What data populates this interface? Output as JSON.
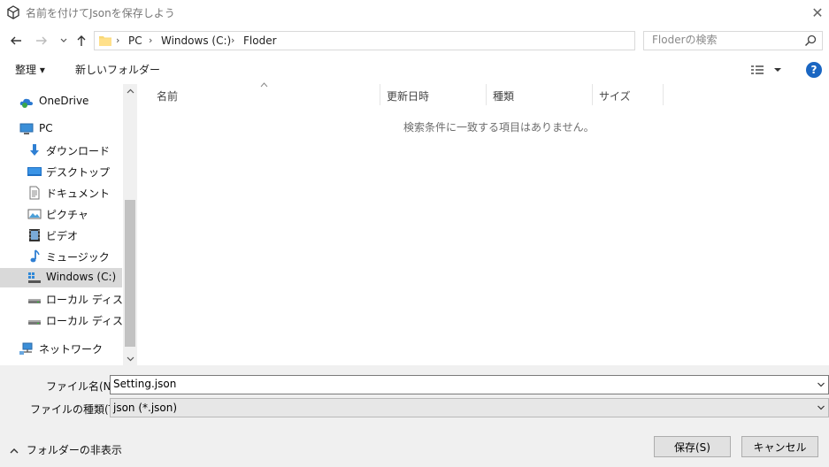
{
  "window": {
    "title": "名前を付けてJsonを保存しよう",
    "close_glyph": "✕"
  },
  "address": {
    "crumbs": [
      "PC",
      "Windows (C:)",
      "Floder"
    ],
    "separator": "›"
  },
  "search": {
    "placeholder": "Floderの検索"
  },
  "toolbar": {
    "organize": "整理 ▾",
    "new_folder": "新しいフォルダー",
    "help": "?"
  },
  "nav": {
    "items": [
      {
        "label": "OneDrive",
        "icon": "onedrive-icon"
      },
      {
        "label": "PC",
        "icon": "pc-icon"
      },
      {
        "label": "ダウンロード",
        "icon": "download-icon"
      },
      {
        "label": "デスクトップ",
        "icon": "desktop-icon"
      },
      {
        "label": "ドキュメント",
        "icon": "document-icon"
      },
      {
        "label": "ピクチャ",
        "icon": "pictures-icon"
      },
      {
        "label": "ビデオ",
        "icon": "video-icon"
      },
      {
        "label": "ミュージック",
        "icon": "music-icon"
      },
      {
        "label": "Windows (C:)",
        "icon": "windows-drive-icon"
      },
      {
        "label": "ローカル ディスク (I:",
        "icon": "drive-icon"
      },
      {
        "label": "ローカル ディスク (X",
        "icon": "drive-icon"
      },
      {
        "label": "ネットワーク",
        "icon": "network-icon"
      }
    ],
    "selected": "Windows (C:)"
  },
  "filelist": {
    "columns": [
      "名前",
      "更新日時",
      "種類",
      "サイズ"
    ],
    "empty_message": "検索条件に一致する項目はありません。"
  },
  "form": {
    "filename_label": "ファイル名(N):",
    "filename_value": "Setting.json",
    "filetype_label": "ファイルの種類(T):",
    "filetype_value": "json (*.json)"
  },
  "footer": {
    "hide_folders": "フォルダーの非表示",
    "save": "保存(S)",
    "cancel": "キャンセル"
  },
  "colors": {
    "accent": "#1a66c2",
    "selection": "#d9d9d9"
  }
}
